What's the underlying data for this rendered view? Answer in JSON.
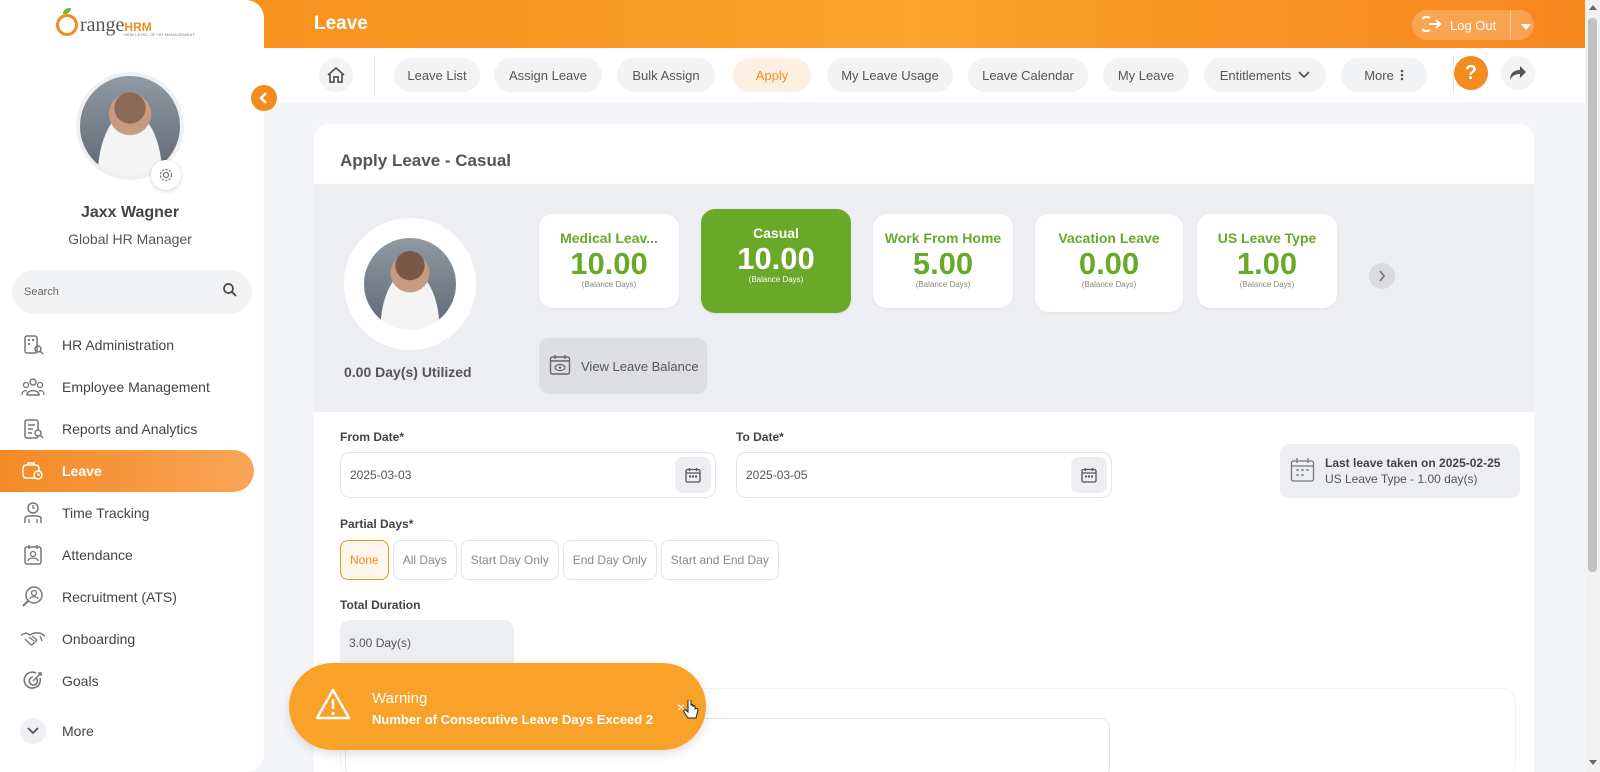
{
  "app": {
    "logo_main": "range",
    "logo_brand": "HRM",
    "logo_tagline": "NEW LEVEL OF HR MANAGEMENT",
    "page_title": "Leave"
  },
  "user": {
    "name": "Jaxx Wagner",
    "role": "Global HR Manager"
  },
  "search": {
    "placeholder": "Search"
  },
  "sidebar": {
    "items": [
      {
        "label": "HR Administration",
        "icon": "hr-admin-icon"
      },
      {
        "label": "Employee Management",
        "icon": "employee-mgmt-icon"
      },
      {
        "label": "Reports and Analytics",
        "icon": "reports-icon"
      },
      {
        "label": "Leave",
        "icon": "leave-icon",
        "active": true
      },
      {
        "label": "Time Tracking",
        "icon": "time-tracking-icon"
      },
      {
        "label": "Attendance",
        "icon": "attendance-icon"
      },
      {
        "label": "Recruitment (ATS)",
        "icon": "recruitment-icon"
      },
      {
        "label": "Onboarding",
        "icon": "onboarding-icon"
      },
      {
        "label": "Goals",
        "icon": "goals-icon"
      }
    ],
    "more_label": "More"
  },
  "header": {
    "logout_label": "Log Out"
  },
  "tabs": [
    {
      "label": "Leave List"
    },
    {
      "label": "Assign Leave"
    },
    {
      "label": "Bulk Assign"
    },
    {
      "label": "Apply",
      "active": true
    },
    {
      "label": "My Leave Usage"
    },
    {
      "label": "Leave Calendar"
    },
    {
      "label": "My Leave"
    },
    {
      "label": "Entitlements"
    },
    {
      "label": "More"
    }
  ],
  "form": {
    "title": "Apply Leave - Casual",
    "utilized": "0.00 Day(s) Utilized",
    "balances": [
      {
        "type": "Medical Leav...",
        "value": "10.00",
        "unit": "(Balance Days)"
      },
      {
        "type": "Casual",
        "value": "10.00",
        "unit": "(Balance Days)",
        "active": true
      },
      {
        "type": "Work From Home",
        "value": "5.00",
        "unit": "(Balance Days)"
      },
      {
        "type": "Vacation Leave",
        "value": "0.00",
        "unit": "(Balance Days)"
      },
      {
        "type": "US Leave Type",
        "value": "1.00",
        "unit": "(Balance Days)"
      }
    ],
    "view_balance_label": "View Leave Balance",
    "from_date_label": "From Date*",
    "from_date_value": "2025-03-03",
    "to_date_label": "To Date*",
    "to_date_value": "2025-03-05",
    "last_leave_line1": "Last leave taken on 2025-02-25",
    "last_leave_line2": "US Leave Type - 1.00 day(s)",
    "partial_label": "Partial Days*",
    "partial_options": [
      "None",
      "All Days",
      "Start Day Only",
      "End Day Only",
      "Start and End Day"
    ],
    "partial_selected": "None",
    "duration_label": "Total Duration",
    "duration_value": "3.00 Day(s)"
  },
  "toast": {
    "title": "Warning",
    "message": "Number of Consecutive Leave Days Exceed 2",
    "close": "×"
  },
  "colors": {
    "accent_orange": "#f28c1f",
    "balance_green": "#6aa829",
    "toast_orange": "#f9a22a"
  }
}
